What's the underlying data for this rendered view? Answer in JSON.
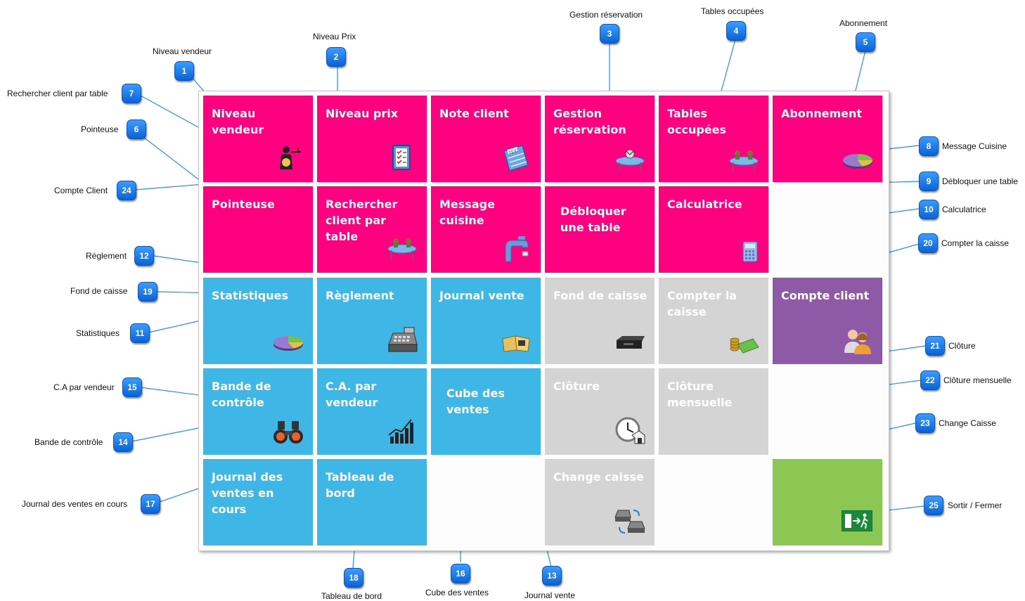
{
  "tiles": {
    "niveau_vendeur": {
      "label": "Niveau vendeur",
      "icon": "waiter-icon"
    },
    "niveau_prix": {
      "label": "Niveau prix",
      "icon": "price-list-icon"
    },
    "note_client": {
      "label": "Note client",
      "icon": "note-icon"
    },
    "gestion_reservation": {
      "label": "Gestion réservation",
      "icon": "reservation-table-icon"
    },
    "tables_occupees": {
      "label": "Tables occupées",
      "icon": "table-icon"
    },
    "abonnement": {
      "label": "Abonnement",
      "icon": "pie-chart-icon"
    },
    "pointeuse": {
      "label": "Pointeuse",
      "icon": ""
    },
    "rechercher_client": {
      "label": "Rechercher client par table",
      "icon": "table-icon"
    },
    "message_cuisine": {
      "label": "Message cuisine",
      "icon": "faucet-icon"
    },
    "debloquer_table": {
      "label": "Débloquer une table",
      "icon": ""
    },
    "calculatrice": {
      "label": "Calculatrice",
      "icon": "calculator-icon"
    },
    "statistiques": {
      "label": "Statistiques",
      "icon": "pie-chart-icon"
    },
    "reglement": {
      "label": "Règlement",
      "icon": "cash-register-icon"
    },
    "journal_vente": {
      "label": "Journal vente",
      "icon": "book-icon"
    },
    "fond_de_caisse": {
      "label": "Fond de caisse",
      "icon": "cash-drawer-icon"
    },
    "compter_caisse": {
      "label": "Compter la caisse",
      "icon": "money-icon"
    },
    "compte_client": {
      "label": "Compte client",
      "icon": "users-icon"
    },
    "bande_controle": {
      "label": "Bande de contrôle",
      "icon": "binoculars-icon"
    },
    "ca_vendeur": {
      "label": "C.A. par vendeur",
      "icon": "bar-chart-icon"
    },
    "cube_ventes": {
      "label": "Cube des ventes",
      "icon": ""
    },
    "cloture": {
      "label": "Clôture",
      "icon": "clock-icon"
    },
    "cloture_mensuelle": {
      "label": "Clôture mensuelle",
      "icon": ""
    },
    "journal_en_cours": {
      "label": "Journal des ventes en cours",
      "icon": ""
    },
    "tableau_de_bord": {
      "label": "Tableau de bord",
      "icon": ""
    },
    "change_caisse": {
      "label": "Change caisse",
      "icon": "swap-registers-icon"
    },
    "sortir": {
      "label": "",
      "icon": "exit-sign-icon"
    }
  },
  "callouts": [
    {
      "n": "1",
      "text": "Niveau vendeur"
    },
    {
      "n": "2",
      "text": "Niveau Prix"
    },
    {
      "n": "3",
      "text": "Gestion réservation"
    },
    {
      "n": "4",
      "text": "Tables occupées"
    },
    {
      "n": "5",
      "text": "Abonnement"
    },
    {
      "n": "6",
      "text": "Pointeuse"
    },
    {
      "n": "7",
      "text": "Rechercher client par table"
    },
    {
      "n": "8",
      "text": "Message Cuisine"
    },
    {
      "n": "9",
      "text": "Débloquer une table"
    },
    {
      "n": "10",
      "text": "Calculatrice"
    },
    {
      "n": "11",
      "text": "Statistiques"
    },
    {
      "n": "12",
      "text": "Réglement"
    },
    {
      "n": "13",
      "text": "Journal vente"
    },
    {
      "n": "14",
      "text": "Bande de contrôle"
    },
    {
      "n": "15",
      "text": "C.A par vendeur"
    },
    {
      "n": "16",
      "text": "Cube des ventes"
    },
    {
      "n": "17",
      "text": "Journal des ventes en cours"
    },
    {
      "n": "18",
      "text": "Tableau de bord"
    },
    {
      "n": "19",
      "text": "Fond de caisse"
    },
    {
      "n": "20",
      "text": "Compter la caisse"
    },
    {
      "n": "21",
      "text": "Clôture"
    },
    {
      "n": "22",
      "text": "Clôture mensuelle"
    },
    {
      "n": "23",
      "text": "Change Caisse"
    },
    {
      "n": "24",
      "text": "Compte Client"
    },
    {
      "n": "25",
      "text": "Sortir / Fermer"
    }
  ],
  "colors": {
    "pink": "#ff0080",
    "blue": "#3fb7e6",
    "gray": "#d4d4d4",
    "purple": "#8e5aa8",
    "green": "#8cc653",
    "callout_badge": "#1a7ff0",
    "leader_line": "#2a8fe8"
  }
}
